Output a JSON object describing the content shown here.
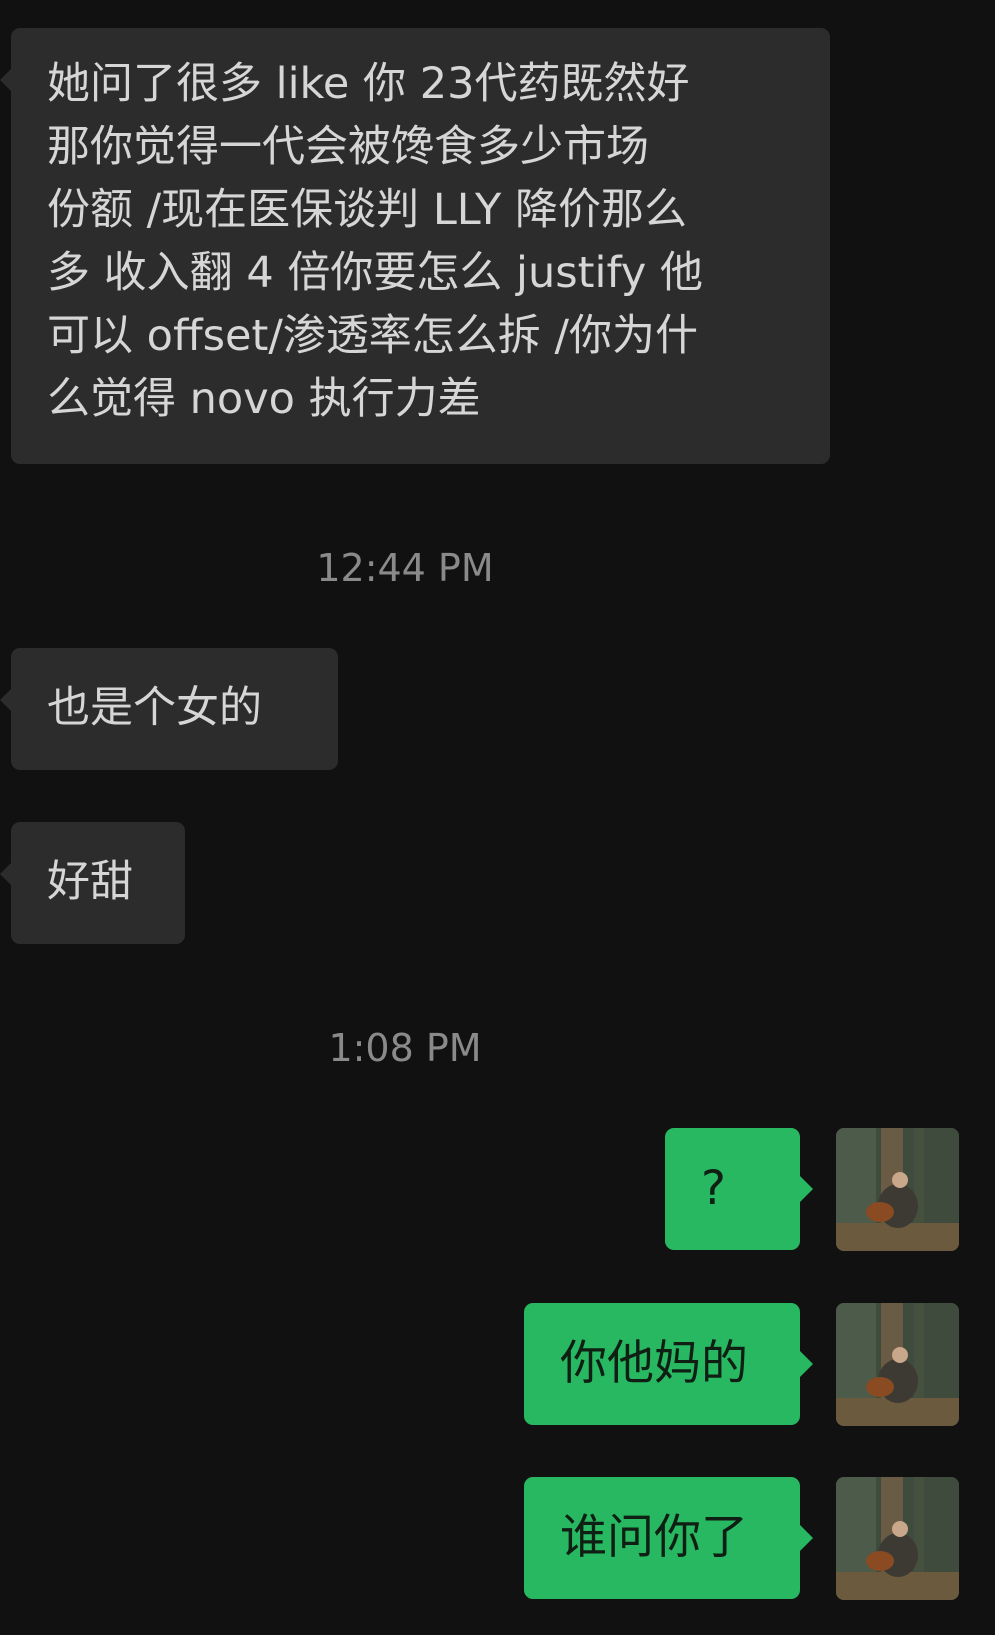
{
  "messages": [
    {
      "direction": "incoming",
      "text": "她问了很多 like 你 23代药既然好 那你觉得一代会被馋食多少市场 份额 /现在医保谈判 LLY 降价那么 多 收入翻 4 倍你要怎么 justify 他 可以 offset/渗透率怎么拆 /你为什 么觉得 novo 执行力差"
    },
    {
      "direction": "incoming",
      "text": "也是个女的"
    },
    {
      "direction": "incoming",
      "text": "好甜"
    },
    {
      "direction": "outgoing",
      "text": "?"
    },
    {
      "direction": "outgoing",
      "text": "你他妈的"
    },
    {
      "direction": "outgoing",
      "text": "谁问你了"
    }
  ],
  "timestamps": [
    "12:44 PM",
    "1:08 PM"
  ],
  "lines_msg1": [
    "她问了很多 like 你 23代药既然好",
    "那你觉得一代会被馋食多少市场",
    "份额 /现在医保谈判 LLY 降价那么",
    "多 收入翻 4 倍你要怎么 justify 他",
    "可以 offset/渗透率怎么拆 /你为什",
    "么觉得 novo 执行力差"
  ],
  "colors": {
    "background": "#111111",
    "incoming_bubble": "#2c2c2c",
    "outgoing_bubble": "#29b862",
    "timestamp_text": "#8a8a8a"
  },
  "icons": {
    "avatar": "user-avatar-photo-forest-guitar"
  }
}
